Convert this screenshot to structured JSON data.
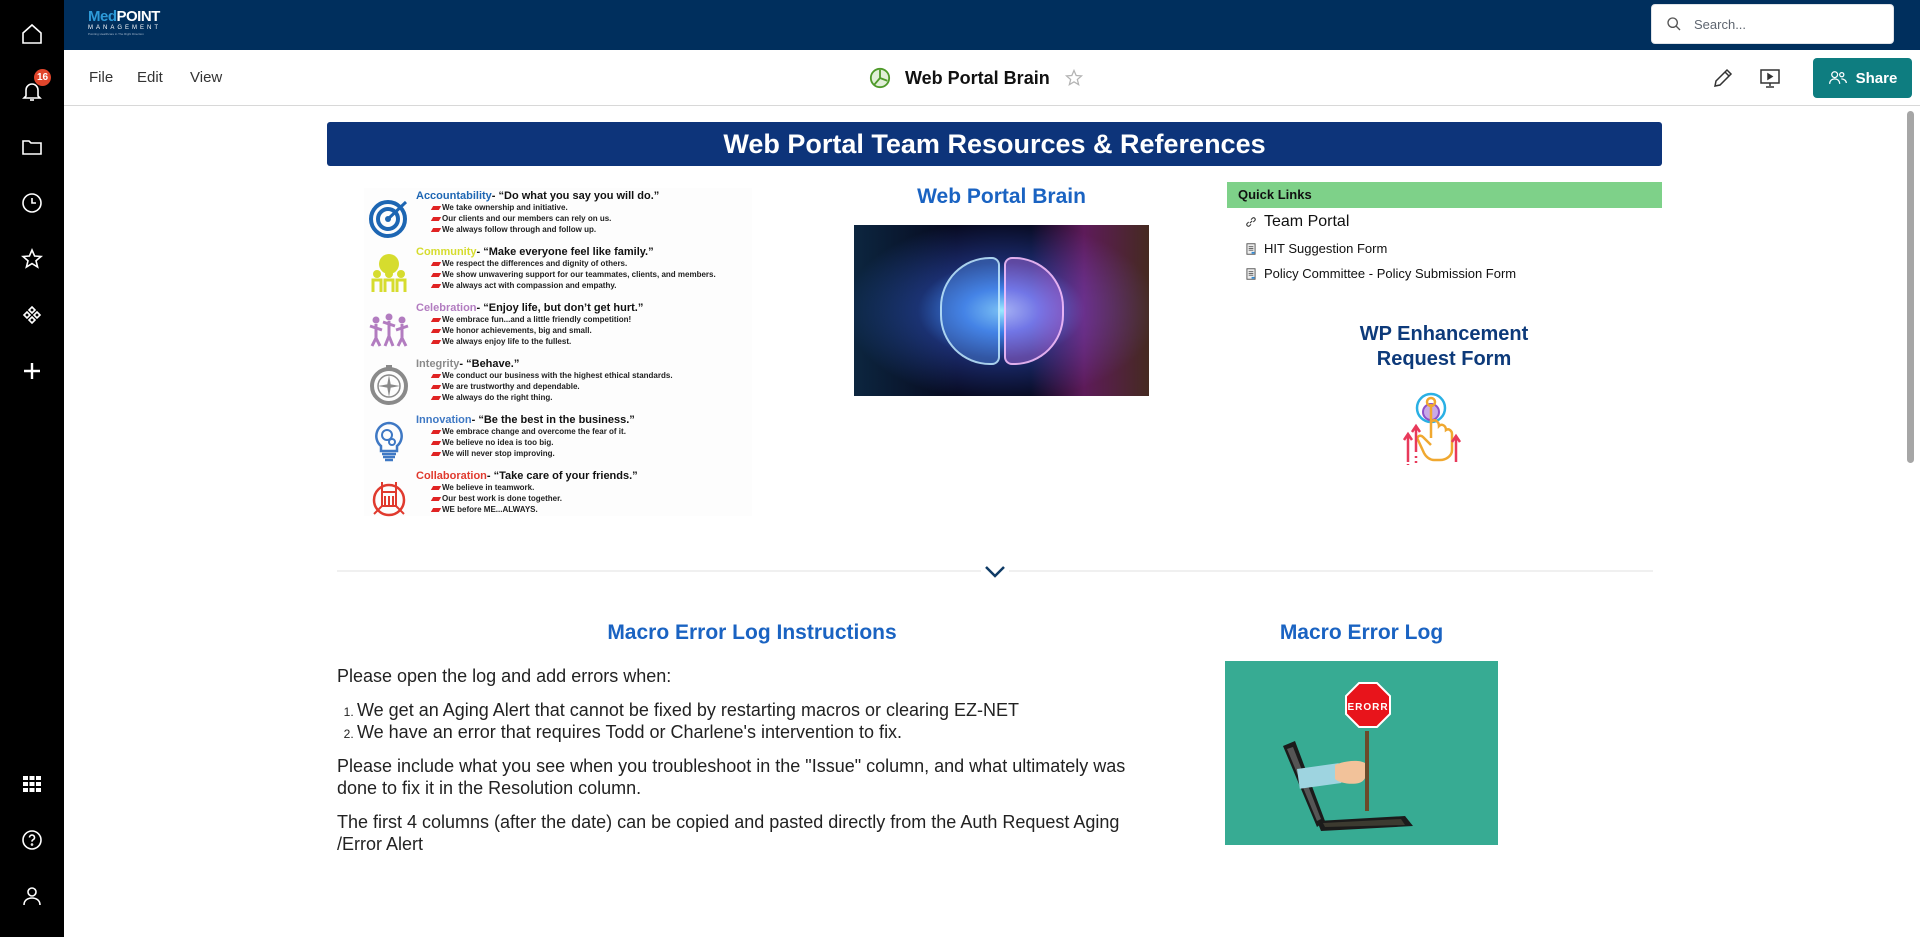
{
  "sidebar": {
    "items": [
      {
        "name": "home",
        "icon": "home-icon"
      },
      {
        "name": "notifications",
        "icon": "bell-icon",
        "badge": "16"
      },
      {
        "name": "files",
        "icon": "folder-icon"
      },
      {
        "name": "recent",
        "icon": "clock-icon"
      },
      {
        "name": "favorites",
        "icon": "star-icon"
      },
      {
        "name": "workapps",
        "icon": "diamonds-icon"
      },
      {
        "name": "create",
        "icon": "plus-icon"
      }
    ],
    "bottom_items": [
      {
        "name": "apps",
        "icon": "grid-icon"
      },
      {
        "name": "help",
        "icon": "help-icon"
      },
      {
        "name": "account",
        "icon": "user-icon"
      }
    ]
  },
  "topbar": {
    "logo": {
      "brand_part1": "Med",
      "brand_part2": "POINT",
      "subtitle": "MANAGEMENT",
      "tagline": "Pointing Healthcare in The Right Direction"
    },
    "search_placeholder": "Search..."
  },
  "menubar": {
    "menus": [
      "File",
      "Edit",
      "View"
    ],
    "doc_title": "Web Portal Brain",
    "doc_icon": "dashboard-icon",
    "share_label": "Share",
    "colors": {
      "share": "#0e7d80"
    }
  },
  "dashboard": {
    "banner_title": "Web Portal Team Resources & References",
    "values": [
      {
        "name": "Accountability",
        "motto": "- “Do what you say you will do.”",
        "color": "#1d66b3",
        "lines": [
          "We take ownership and initiative.",
          "Our clients and our members can rely on us.",
          "We always follow through and follow up."
        ]
      },
      {
        "name": "Community",
        "motto": "- “Make everyone feel like family.”",
        "color": "#d6dc2e",
        "lines": [
          "We respect the differences and dignity of others.",
          "We show unwavering support for our teammates, clients, and members.",
          "We always act with compassion and empathy."
        ]
      },
      {
        "name": "Celebration",
        "motto": "- “Enjoy life, but don’t get hurt.”",
        "color": "#b27cc0",
        "lines": [
          "We embrace fun...and a little friendly competition!",
          "We honor achievements, big and small.",
          "We always enjoy life to the fullest."
        ]
      },
      {
        "name": "Integrity",
        "motto": "- “Behave.”",
        "color": "#8a8a8a",
        "lines": [
          "We conduct our business with the highest ethical standards.",
          "We are trustworthy and dependable.",
          "We always do the right thing."
        ]
      },
      {
        "name": "Innovation",
        "motto": "- “Be the best in the business.”",
        "color": "#3e78c4",
        "lines": [
          "We embrace change and overcome the fear of it.",
          "We believe no idea is too big.",
          "We will never stop improving."
        ]
      },
      {
        "name": "Collaboration",
        "motto": "- “Take care of your friends.”",
        "color": "#e03a2e",
        "lines": [
          "We believe in teamwork.",
          "Our best work is done together.",
          "WE before ME...ALWAYS."
        ]
      }
    ],
    "brain_title": "Web Portal Brain",
    "quick_links": {
      "header": "Quick Links",
      "items": [
        {
          "label": "Team Portal",
          "icon": "link-icon"
        },
        {
          "label": "HIT Suggestion Form",
          "icon": "form-icon"
        },
        {
          "label": "Policy Committee - Policy Submission Form",
          "icon": "form-icon"
        }
      ]
    },
    "wp_enhancement": {
      "line1": "WP Enhancement",
      "line2": "Request Form"
    },
    "macro_instructions": {
      "title": "Macro Error Log Instructions",
      "intro": "Please open the log and add errors when:",
      "list": [
        "We get an Aging Alert that cannot be fixed by restarting macros or clearing EZ-NET",
        "We have an error that requires Todd or Charlene's intervention to fix."
      ],
      "para2": "Please include what you see when you troubleshoot in the \"Issue\" column, and what ultimately was done to fix it in the Resolution column.",
      "para3": "The first 4 columns (after the date) can be copied and pasted directly from the Auth Request Aging /Error Alert"
    },
    "macro_log": {
      "title": "Macro Error Log",
      "sign_text": "ERORR"
    }
  }
}
